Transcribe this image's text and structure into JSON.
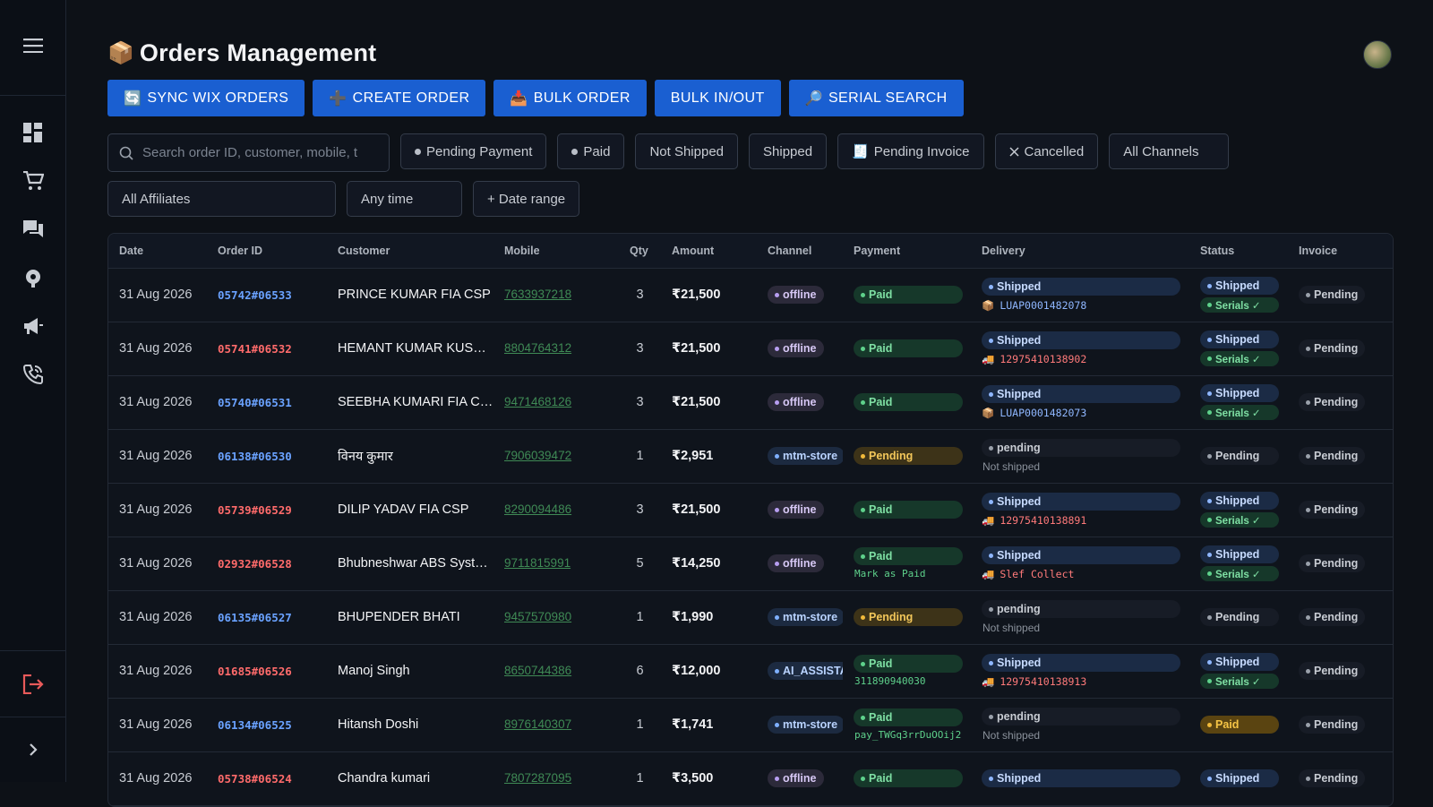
{
  "header": {
    "title_icon": "📦",
    "title": "Orders Management"
  },
  "actions": [
    {
      "icon": "🔄",
      "label": "SYNC WIX ORDERS"
    },
    {
      "icon": "➕",
      "label": "CREATE ORDER"
    },
    {
      "icon": "📥",
      "label": "BULK ORDER"
    },
    {
      "icon": "",
      "label": "BULK IN/OUT"
    },
    {
      "icon": "🔎",
      "label": "SERIAL SEARCH"
    }
  ],
  "search": {
    "placeholder": "Search order ID, customer, mobile, t"
  },
  "filters": {
    "pending_payment": "Pending Payment",
    "paid": "Paid",
    "not_shipped": "Not Shipped",
    "shipped": "Shipped",
    "pending_invoice_icon": "🧾",
    "pending_invoice": "Pending Invoice",
    "cancelled": "Cancelled",
    "all_channels": "All Channels",
    "all_affiliates": "All Affiliates",
    "any_time": "Any time",
    "date_range": "+ Date range"
  },
  "columns": [
    "Date",
    "Order ID",
    "Customer",
    "Mobile",
    "Qty",
    "Amount",
    "Channel",
    "Payment",
    "Delivery",
    "Status",
    "Invoice"
  ],
  "rows": [
    {
      "date": "31 Aug 2026",
      "order_id": "05742#06533",
      "id_color": "blue",
      "customer": "PRINCE KUMAR FIA CSP",
      "mobile": "7633937218",
      "qty": "3",
      "amount": "₹21,500",
      "channel": "offline",
      "payment": "Paid",
      "payment_note": "",
      "delivery": "Shipped",
      "tracking": "LUAP0001482078",
      "tracking_icon": "📦",
      "tracking_color": "blue",
      "status": "Shipped",
      "serials": "Serials ✓",
      "invoice": "Pending"
    },
    {
      "date": "31 Aug 2026",
      "order_id": "05741#06532",
      "id_color": "red",
      "customer": "HEMANT KUMAR KUSH…",
      "mobile": "8804764312",
      "qty": "3",
      "amount": "₹21,500",
      "channel": "offline",
      "payment": "Paid",
      "payment_note": "",
      "delivery": "Shipped",
      "tracking": "12975410138902",
      "tracking_icon": "🚚",
      "tracking_color": "red",
      "status": "Shipped",
      "serials": "Serials ✓",
      "invoice": "Pending"
    },
    {
      "date": "31 Aug 2026",
      "order_id": "05740#06531",
      "id_color": "blue",
      "customer": "SEEBHA KUMARI FIA CSP",
      "mobile": "9471468126",
      "qty": "3",
      "amount": "₹21,500",
      "channel": "offline",
      "payment": "Paid",
      "payment_note": "",
      "delivery": "Shipped",
      "tracking": "LUAP0001482073",
      "tracking_icon": "📦",
      "tracking_color": "blue",
      "status": "Shipped",
      "serials": "Serials ✓",
      "invoice": "Pending"
    },
    {
      "date": "31 Aug 2026",
      "order_id": "06138#06530",
      "id_color": "blue",
      "customer": "विनय कुमार",
      "mobile": "7906039472",
      "qty": "1",
      "amount": "₹2,951",
      "channel": "mtm-store",
      "payment": "Pending",
      "payment_note": "",
      "delivery": "pending",
      "tracking": "Not shipped",
      "tracking_icon": "",
      "tracking_color": "",
      "status": "Pending",
      "serials": "",
      "invoice": "Pending"
    },
    {
      "date": "31 Aug 2026",
      "order_id": "05739#06529",
      "id_color": "red",
      "customer": "DILIP YADAV FIA CSP",
      "mobile": "8290094486",
      "qty": "3",
      "amount": "₹21,500",
      "channel": "offline",
      "payment": "Paid",
      "payment_note": "",
      "delivery": "Shipped",
      "tracking": "12975410138891",
      "tracking_icon": "🚚",
      "tracking_color": "red",
      "status": "Shipped",
      "serials": "Serials ✓",
      "invoice": "Pending"
    },
    {
      "date": "31 Aug 2026",
      "order_id": "02932#06528",
      "id_color": "red",
      "customer": "Bhubneshwar ABS Syst…",
      "mobile": "9711815991",
      "qty": "5",
      "amount": "₹14,250",
      "channel": "offline",
      "payment": "Paid",
      "payment_note": "Mark as Paid",
      "delivery": "Shipped",
      "tracking": "Slef Collect",
      "tracking_icon": "🚚",
      "tracking_color": "red",
      "status": "Shipped",
      "serials": "Serials ✓",
      "invoice": "Pending"
    },
    {
      "date": "31 Aug 2026",
      "order_id": "06135#06527",
      "id_color": "blue",
      "customer": "BHUPENDER BHATI",
      "mobile": "9457570980",
      "qty": "1",
      "amount": "₹1,990",
      "channel": "mtm-store",
      "payment": "Pending",
      "payment_note": "",
      "delivery": "pending",
      "tracking": "Not shipped",
      "tracking_icon": "",
      "tracking_color": "",
      "status": "Pending",
      "serials": "",
      "invoice": "Pending"
    },
    {
      "date": "31 Aug 2026",
      "order_id": "01685#06526",
      "id_color": "red",
      "customer": "Manoj Singh",
      "mobile": "8650744386",
      "qty": "6",
      "amount": "₹12,000",
      "channel": "AI_ASSISTA",
      "payment": "Paid",
      "payment_note": "311890940030",
      "delivery": "Shipped",
      "tracking": "12975410138913",
      "tracking_icon": "🚚",
      "tracking_color": "red",
      "status": "Shipped",
      "serials": "Serials ✓",
      "invoice": "Pending"
    },
    {
      "date": "31 Aug 2026",
      "order_id": "06134#06525",
      "id_color": "blue",
      "customer": "Hitansh Doshi",
      "mobile": "8976140307",
      "qty": "1",
      "amount": "₹1,741",
      "channel": "mtm-store",
      "payment": "Paid",
      "payment_note": "pay_TWGq3rrDuOOij2",
      "delivery": "pending",
      "tracking": "Not shipped",
      "tracking_icon": "",
      "tracking_color": "",
      "status": "Paid",
      "serials": "",
      "invoice": "Pending"
    },
    {
      "date": "31 Aug 2026",
      "order_id": "05738#06524",
      "id_color": "red",
      "customer": "Chandra kumari",
      "mobile": "7807287095",
      "qty": "1",
      "amount": "₹3,500",
      "channel": "offline",
      "payment": "Paid",
      "payment_note": "",
      "delivery": "Shipped",
      "tracking": "",
      "tracking_icon": "",
      "tracking_color": "",
      "status": "Shipped",
      "serials": "",
      "invoice": "Pending"
    }
  ]
}
